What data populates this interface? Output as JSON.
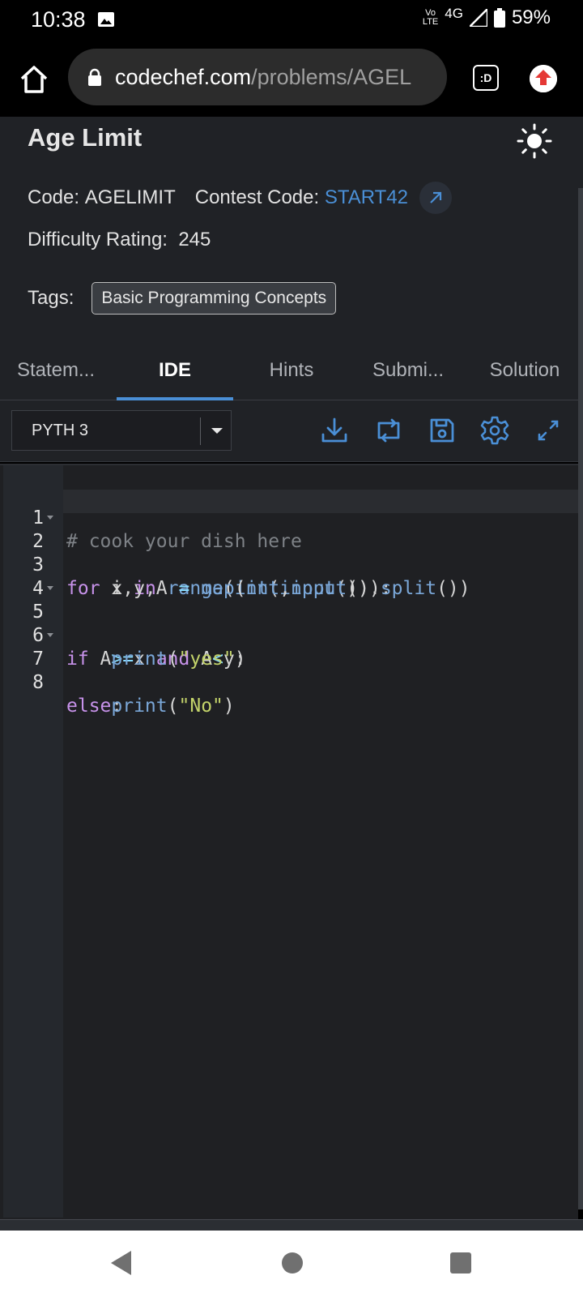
{
  "status": {
    "time": "10:38",
    "volte_top": "Vo",
    "volte_bottom": "LTE",
    "network": "4G",
    "battery": "59%"
  },
  "browser": {
    "url_domain": "codechef.com",
    "url_path": "/problems/AGEL",
    "tab_switcher_label": ":D"
  },
  "problem": {
    "title": "Age Limit",
    "code_label": "Code:",
    "code_value": "AGELIMIT",
    "contest_label": "Contest Code:",
    "contest_value": "START42",
    "difficulty_label": "Difficulty Rating:",
    "difficulty_value": "245",
    "tags_label": "Tags:",
    "tags": [
      "Basic Programming Concepts"
    ]
  },
  "tabs": [
    {
      "label": "Statem..."
    },
    {
      "label": "IDE"
    },
    {
      "label": "Hints"
    },
    {
      "label": "Submi..."
    },
    {
      "label": "Solution"
    }
  ],
  "editor": {
    "language": "PYTH 3",
    "line_numbers": [
      "1",
      "2",
      "3",
      "4",
      "5",
      "6",
      "7",
      "8"
    ]
  },
  "colors": {
    "accent": "#4a8fd6",
    "background": "#202226",
    "editor_background": "#1f2023"
  }
}
